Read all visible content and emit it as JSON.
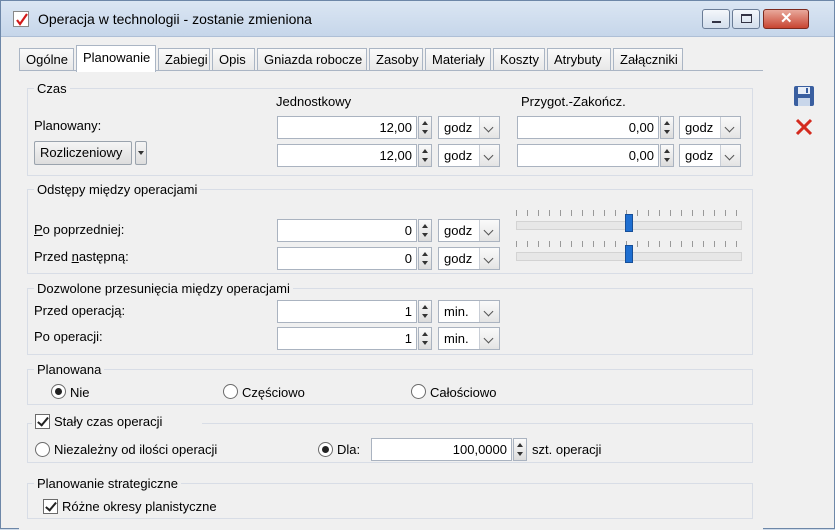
{
  "window": {
    "title": "Operacja w technologii - zostanie zmieniona"
  },
  "tabs": [
    {
      "label": "Ogólne"
    },
    {
      "label": "Planowanie"
    },
    {
      "label": "Zabiegi"
    },
    {
      "label": "Opis"
    },
    {
      "label": "Gniazda robocze"
    },
    {
      "label": "Zasoby"
    },
    {
      "label": "Materiały"
    },
    {
      "label": "Koszty"
    },
    {
      "label": "Atrybuty"
    },
    {
      "label": "Załączniki"
    }
  ],
  "active_tab": "Planowanie",
  "czas": {
    "title": "Czas",
    "col_unit": "Jednostkowy",
    "col_prep": "Przygot.-Zakończ.",
    "row1_label": "Planowany:",
    "row2_button": "Rozliczeniowy",
    "row1_unit_value": "12,00",
    "row1_unit_combo": "godz",
    "row1_prep_value": "0,00",
    "row1_prep_combo": "godz",
    "row2_unit_value": "12,00",
    "row2_unit_combo": "godz",
    "row2_prep_value": "0,00",
    "row2_prep_combo": "godz"
  },
  "odstepy": {
    "title": "Odstępy między operacjami",
    "po_label_first": "P",
    "po_label_rest": "o poprzedniej:",
    "przed_label_first": "Przed ",
    "przed_label_ul": "n",
    "przed_label_rest": "astępną:",
    "po_value": "0",
    "po_combo": "godz",
    "przed_value": "0",
    "przed_combo": "godz",
    "po_slider_level": 0.5,
    "przed_slider_level": 0.5
  },
  "przesuniecia": {
    "title": "Dozwolone przesunięcia między operacjami",
    "przed_label": "Przed operacją:",
    "przed_value": "1",
    "przed_combo": "min.",
    "po_label": "Po operacji:",
    "po_value": "1",
    "po_combo": "min."
  },
  "planowana": {
    "title": "Planowana",
    "options": [
      "Nie",
      "Częściowo",
      "Całościowo"
    ],
    "selected": "Nie"
  },
  "staly_czas": {
    "checkbox_label": "Stały czas operacji",
    "checked": true,
    "opt1": "Niezależny od ilości operacji",
    "opt2": "Dla:",
    "selected": "Dla:",
    "dla_value": "100,0000",
    "dla_suffix": "szt. operacji"
  },
  "strategiczne": {
    "title": "Planowanie strategiczne",
    "checkbox_label": "Różne okresy planistyczne",
    "checked": true
  },
  "colors": {
    "accent": "#1f6fd1",
    "close": "#c84531",
    "delete_x": "#d42a1e",
    "save_icon": "#3a5fa0"
  }
}
